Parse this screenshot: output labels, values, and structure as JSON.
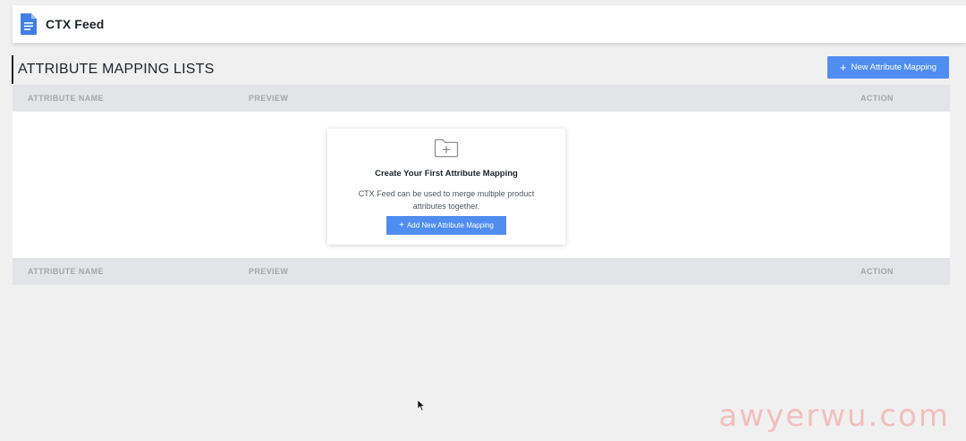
{
  "app": {
    "title": "CTX Feed",
    "icon": "document-icon",
    "accent": "#4f8df0"
  },
  "page": {
    "heading": "ATTRIBUTE MAPPING LISTS",
    "new_button_label": "New Attribute Mapping"
  },
  "table": {
    "columns": [
      "ATTRIBUTE NAME",
      "PREVIEW",
      "ACTION"
    ],
    "empty_state": {
      "icon": "folder-plus-icon",
      "title": "Create Your First Attribute Mapping",
      "description": "CTX Feed can be used to merge multiple product attributes together.",
      "button_label": "Add New Attribute Mapping"
    }
  },
  "watermark": "awyerwu.com"
}
